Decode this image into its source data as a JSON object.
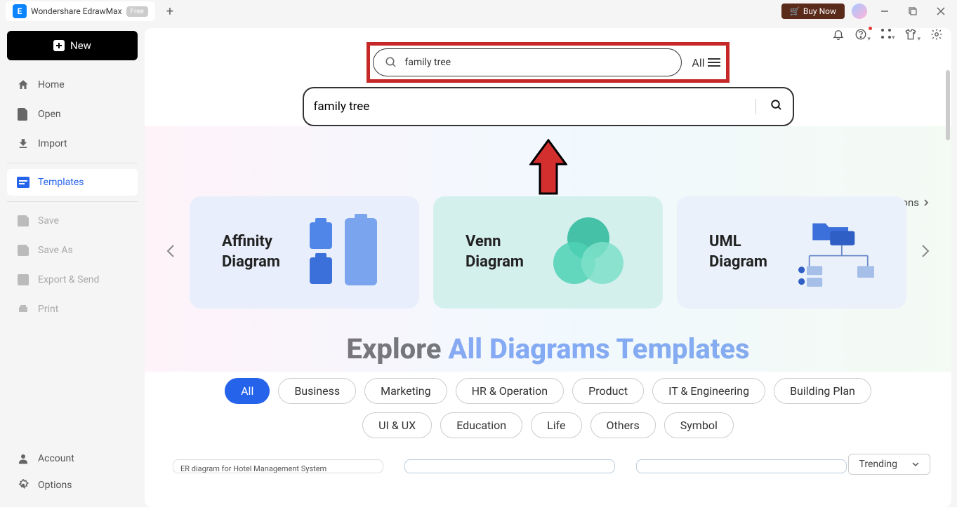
{
  "titlebar": {
    "app_name": "Wondershare EdrawMax",
    "free_badge": "Free",
    "buy_now": "Buy Now"
  },
  "sidebar": {
    "new_label": "New",
    "items": [
      {
        "label": "Home",
        "icon": "home-icon"
      },
      {
        "label": "Open",
        "icon": "file-icon"
      },
      {
        "label": "Import",
        "icon": "import-icon"
      }
    ],
    "templates_label": "Templates",
    "disabled_items": [
      {
        "label": "Save",
        "icon": "save-icon"
      },
      {
        "label": "Save As",
        "icon": "saveas-icon"
      },
      {
        "label": "Export & Send",
        "icon": "export-icon"
      },
      {
        "label": "Print",
        "icon": "print-icon"
      }
    ],
    "footer": [
      {
        "label": "Account",
        "icon": "account-icon"
      },
      {
        "label": "Options",
        "icon": "gear-icon"
      }
    ]
  },
  "search": {
    "pill_value": "family tree",
    "all_label": "All",
    "big_value": "family tree"
  },
  "collections_link": "All Collections",
  "carousel": {
    "cards": [
      {
        "title_l1": "Affinity",
        "title_l2": "Diagram"
      },
      {
        "title_l1": "Venn",
        "title_l2": "Diagram"
      },
      {
        "title_l1": "UML",
        "title_l2": "Diagram"
      }
    ]
  },
  "explore": {
    "black": "Explore ",
    "blue": "All Diagrams Templates"
  },
  "categories": [
    "All",
    "Business",
    "Marketing",
    "HR & Operation",
    "Product",
    "IT & Engineering",
    "Building Plan",
    "UI & UX",
    "Education",
    "Life",
    "Others",
    "Symbol"
  ],
  "trending_label": "Trending",
  "templates_peek": [
    "ER diagram for Hotel Management System",
    "",
    ""
  ]
}
